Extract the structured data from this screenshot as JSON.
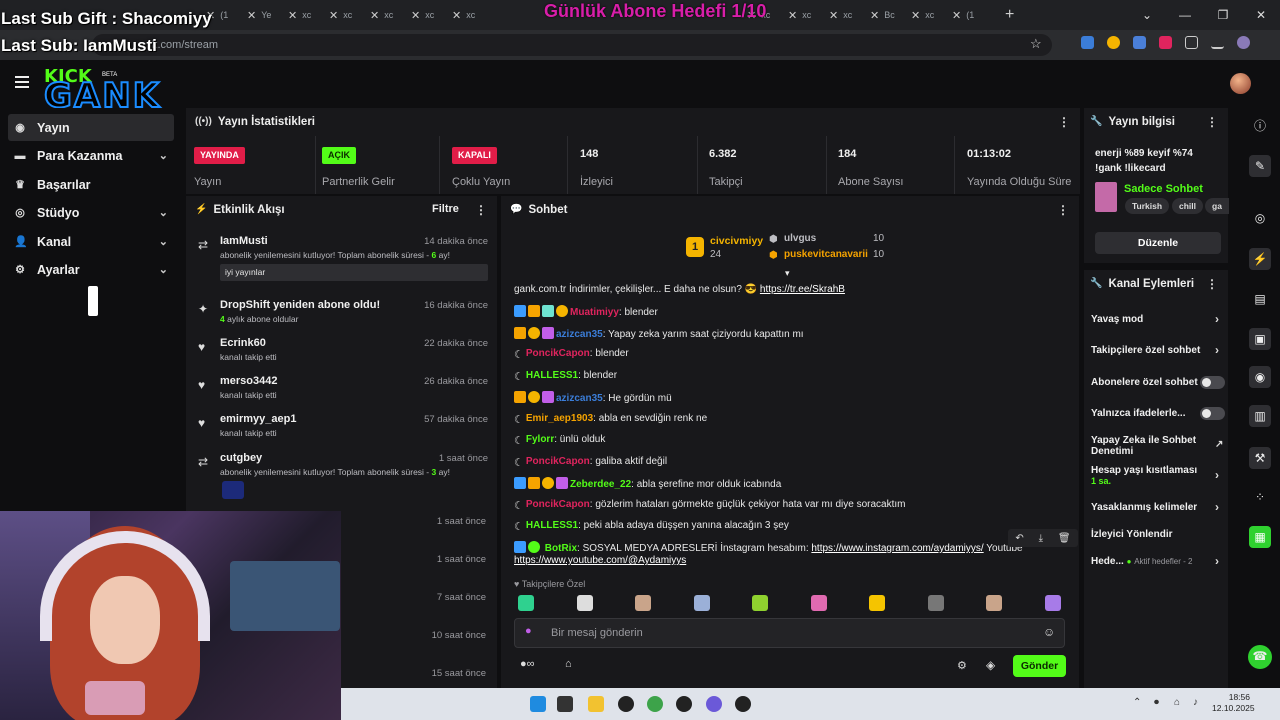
{
  "browser": {
    "tabs": [
      {
        "label": "(1"
      },
      {
        "label": "Ye"
      },
      {
        "label": "xc"
      },
      {
        "label": "xc"
      },
      {
        "label": "xc"
      },
      {
        "label": "xc"
      },
      {
        "label": "xc"
      }
    ],
    "tabs_right": [
      {
        "label": "xc"
      },
      {
        "label": "xc"
      },
      {
        "label": "xc"
      },
      {
        "label": "Bc"
      },
      {
        "label": "xc"
      },
      {
        "label": "(1"
      }
    ],
    "url": "k.com/stream"
  },
  "overlays": {
    "last_sub_gift": "Last Sub Gift : Shacomiyy",
    "last_sub": "Last Sub: IamMusti",
    "daily_goal": "Günlük Abone Hedefi 1/10"
  },
  "logo": {
    "kick": "KICK",
    "beta": "BETA",
    "gank": "GANK"
  },
  "sidebar": {
    "items": [
      {
        "label": "Yayın",
        "icon": "stream-icon"
      },
      {
        "label": "Para Kazanma",
        "icon": "money-icon"
      },
      {
        "label": "Başarılar",
        "icon": "trophy-icon"
      },
      {
        "label": "Stüdyo",
        "icon": "studio-icon"
      },
      {
        "label": "Kanal",
        "icon": "channel-icon"
      },
      {
        "label": "Ayarlar",
        "icon": "gear-icon"
      }
    ]
  },
  "stats": {
    "title": "Yayın İstatistikleri",
    "status": [
      {
        "badge": "YAYINDA",
        "label": "Yayın"
      },
      {
        "badge": "AÇIK",
        "label": "Partnerlik Gelir"
      },
      {
        "badge": "KAPALI",
        "label": "Çoklu Yayın"
      }
    ],
    "metrics": [
      {
        "value": "148",
        "label": "İzleyici"
      },
      {
        "value": "6.382",
        "label": "Takipçi"
      },
      {
        "value": "184",
        "label": "Abone Sayısı"
      },
      {
        "value": "01:13:02",
        "label": "Yayında Olduğu Süre"
      }
    ]
  },
  "activity": {
    "title": "Etkinlik Akışı",
    "filter": "Filtre",
    "items": [
      {
        "name": "IamMusti",
        "time": "14 dakika önce",
        "sub_prefix": "abonelik yenilemesini kutluyor! Toplam abonelik süresi - ",
        "sub_count": "6",
        "sub_suffix": " ay!",
        "message": "iyi yayınlar",
        "icon": "renew-icon"
      },
      {
        "name": "DropShift yeniden abone oldu!",
        "time": "16 dakika önce",
        "sub_count": "4",
        "sub_suffix": " aylık abone oldular",
        "icon": "star-icon"
      },
      {
        "name": "Ecrink60",
        "time": "22 dakika önce",
        "sub": "kanalı takip etti",
        "icon": "heart-icon"
      },
      {
        "name": "merso3442",
        "time": "26 dakika önce",
        "sub": "kanalı takip etti",
        "icon": "heart-icon"
      },
      {
        "name": "emirmyy_aep1",
        "time": "57 dakika önce",
        "sub": "kanalı takip etti",
        "icon": "heart-icon"
      },
      {
        "name": "cutgbey",
        "time": "1 saat önce",
        "sub_prefix": "abonelik yenilemesini kutluyor! Toplam abonelik süresi - ",
        "sub_count": "3",
        "sub_suffix": " ay!",
        "icon": "renew-icon"
      }
    ],
    "more_times": [
      "1 saat önce",
      "1 saat önce",
      "7 saat önce",
      "10 saat önce",
      "15 saat önce"
    ]
  },
  "chat": {
    "title": "Sohbet",
    "top": [
      {
        "rank": "1",
        "name": "civcivmiyy",
        "count": "24"
      },
      {
        "name": "ulvgus",
        "count": "10"
      },
      {
        "name": "puskevitcanavarii",
        "count": "10"
      }
    ],
    "pinned_text": "gank.com.tr İndirimler, çekilişler... E daha ne olsun?",
    "pinned_link": "https://tr.ee/SkrahB",
    "messages": [
      {
        "badges": [
          "mod",
          "crown",
          "gift",
          "one"
        ],
        "user": "Muatimiyy",
        "color": "#e0245e",
        "text": "blender"
      },
      {
        "badges": [
          "crown",
          "one",
          "sub"
        ],
        "user": "azizcan35",
        "color": "#3b7dd8",
        "text": "Yapay zeka yarım saat çiziyordu kapattın mı"
      },
      {
        "badges": [
          "moon"
        ],
        "user": "PoncikCapon",
        "color": "#e0245e",
        "text": "blender"
      },
      {
        "badges": [
          "moon"
        ],
        "user": "HALLESS1",
        "color": "#53fc18",
        "text": "blender"
      },
      {
        "badges": [
          "crown",
          "one",
          "sub"
        ],
        "user": "azizcan35",
        "color": "#3b7dd8",
        "text": "He gördün mü"
      },
      {
        "badges": [
          "moon"
        ],
        "user": "Emir_aep1903",
        "color": "#f5a300",
        "text": "abla en sevdiğin renk ne"
      },
      {
        "badges": [
          "moon"
        ],
        "user": "Fylorr",
        "color": "#53fc18",
        "text": "ünlü olduk"
      },
      {
        "badges": [
          "moon"
        ],
        "user": "PoncikCapon",
        "color": "#e0245e",
        "text": "galiba aktif değil"
      },
      {
        "badges": [
          "mod",
          "crown",
          "one",
          "sub"
        ],
        "user": "Zeberdee_22",
        "color": "#53fc18",
        "text": "abla şerefine mor olduk icabında"
      },
      {
        "badges": [
          "moon"
        ],
        "user": "PoncikCapon",
        "color": "#e0245e",
        "text": "gözlerim hataları görmekte güçlük çekiyor hata var mı diye soracaktım"
      },
      {
        "badges": [
          "moon"
        ],
        "user": "HALLESS1",
        "color": "#53fc18",
        "text": "peki abla adaya düşşen yanına alacağın 3 şey"
      }
    ],
    "bot": {
      "user": "BotRix",
      "text": "SOSYAL MEDYA ADRESLERİ İnstagram hesabım:",
      "link1": "https://www.instagram.com/aydamiyys/",
      "text2": "Youtube",
      "link2": "https://www.youtube.com/@Aydamiyys"
    },
    "followers_only": "Takipçilere Özel",
    "input_placeholder": "Bir mesaj gönderin",
    "send_label": "Gönder"
  },
  "stream_info": {
    "title": "Yayın bilgisi",
    "stream_title_line1": "enerji %89 keyif %74",
    "stream_title_line2": "!gank !likecard",
    "category": "Sadece Sohbet",
    "tags": [
      "Turkish",
      "chill",
      "ga"
    ],
    "edit_label": "Düzenle"
  },
  "channel_actions": {
    "title": "Kanal Eylemleri",
    "items": [
      {
        "label": "Yavaş mod"
      },
      {
        "label": "Takipçilere özel sohbet"
      },
      {
        "label": "Abonelere özel sohbet"
      },
      {
        "label": "Yalnızca ifadelerle..."
      },
      {
        "label": "Yapay Zeka ile Sohbet Denetimi"
      },
      {
        "label": "Hesap yaşı kısıtlaması",
        "sub": "1 sa."
      },
      {
        "label": "Yasaklanmış kelimeler"
      },
      {
        "label": "İzleyici Yönlendir"
      },
      {
        "label": "Hede...",
        "sub": "Aktif hedefler - 2"
      }
    ]
  },
  "taskbar": {
    "time": "18:56",
    "date": "12.10.2025"
  },
  "colors": {
    "accent": "#53fc18",
    "live": "#e11d48",
    "panel": "#18181b",
    "bg": "#0e0e10"
  }
}
